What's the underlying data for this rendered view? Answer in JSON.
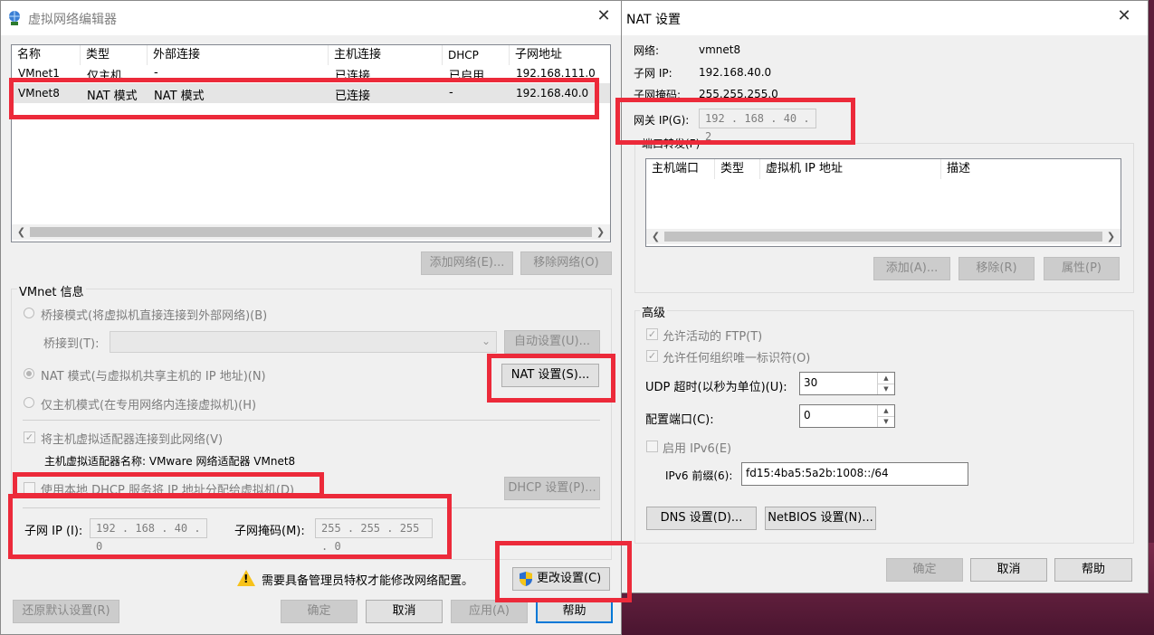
{
  "left": {
    "title": "虚拟网络编辑器",
    "table": {
      "headers": [
        "名称",
        "类型",
        "外部连接",
        "主机连接",
        "DHCP",
        "子网地址"
      ],
      "rows": [
        [
          "VMnet1",
          "仅主机...",
          "-",
          "已连接",
          "已启用",
          "192.168.111.0"
        ],
        [
          "VMnet8",
          "NAT 模式",
          "NAT 模式",
          "已连接",
          "-",
          "192.168.40.0"
        ]
      ]
    },
    "add_network": "添加网络(E)...",
    "remove_network": "移除网络(O)",
    "vmnet_info": "VMnet 信息",
    "bridged_mode": "桥接模式(将虚拟机直接连接到外部网络)(B)",
    "bridged_to": "桥接到(T):",
    "auto_settings": "自动设置(U)...",
    "nat_mode": "NAT 模式(与虚拟机共享主机的 IP 地址)(N)",
    "nat_settings": "NAT 设置(S)...",
    "host_only": "仅主机模式(在专用网络内连接虚拟机)(H)",
    "connect_adapter": "将主机虚拟适配器连接到此网络(V)",
    "adapter_name": "主机虚拟适配器名称: VMware 网络适配器 VMnet8",
    "use_dhcp": "使用本地 DHCP 服务将 IP 地址分配给虚拟机(D)",
    "dhcp_settings": "DHCP 设置(P)...",
    "subnet_ip_label": "子网 IP (I):",
    "subnet_ip": "192 . 168 . 40  .  0",
    "subnet_mask_label": "子网掩码(M):",
    "subnet_mask": "255 . 255 . 255 .  0",
    "admin_warning": "需要具备管理员特权才能修改网络配置。",
    "change_settings": "更改设置(C)",
    "restore_defaults": "还原默认设置(R)",
    "ok": "确定",
    "cancel": "取消",
    "apply": "应用(A)",
    "help": "帮助"
  },
  "right": {
    "title": "NAT 设置",
    "network_label": "网络:",
    "network": "vmnet8",
    "subnet_ip_label": "子网 IP:",
    "subnet_ip": "192.168.40.0",
    "subnet_mask_label": "子网掩码:",
    "subnet_mask": "255.255.255.0",
    "gateway_label": "网关 IP(G):",
    "gateway": "192 . 168 . 40  .  2",
    "port_forwarding": "端口转发(F)",
    "pf_headers": [
      "主机端口",
      "类型",
      "虚拟机 IP 地址",
      "描述"
    ],
    "pf_add": "添加(A)...",
    "pf_remove": "移除(R)",
    "pf_props": "属性(P)",
    "advanced": "高级",
    "allow_ftp": "允许活动的 FTP(T)",
    "allow_oui": "允许任何组织唯一标识符(O)",
    "udp_timeout_label": "UDP 超时(以秒为单位)(U):",
    "udp_timeout": "30",
    "config_port_label": "配置端口(C):",
    "config_port": "0",
    "enable_ipv6": "启用 IPv6(E)",
    "ipv6_prefix_label": "IPv6 前缀(6):",
    "ipv6_prefix": "fd15:4ba5:5a2b:1008::/64",
    "dns_settings": "DNS 设置(D)...",
    "netbios_settings": "NetBIOS 设置(N)...",
    "ok": "确定",
    "cancel": "取消",
    "help": "帮助"
  }
}
